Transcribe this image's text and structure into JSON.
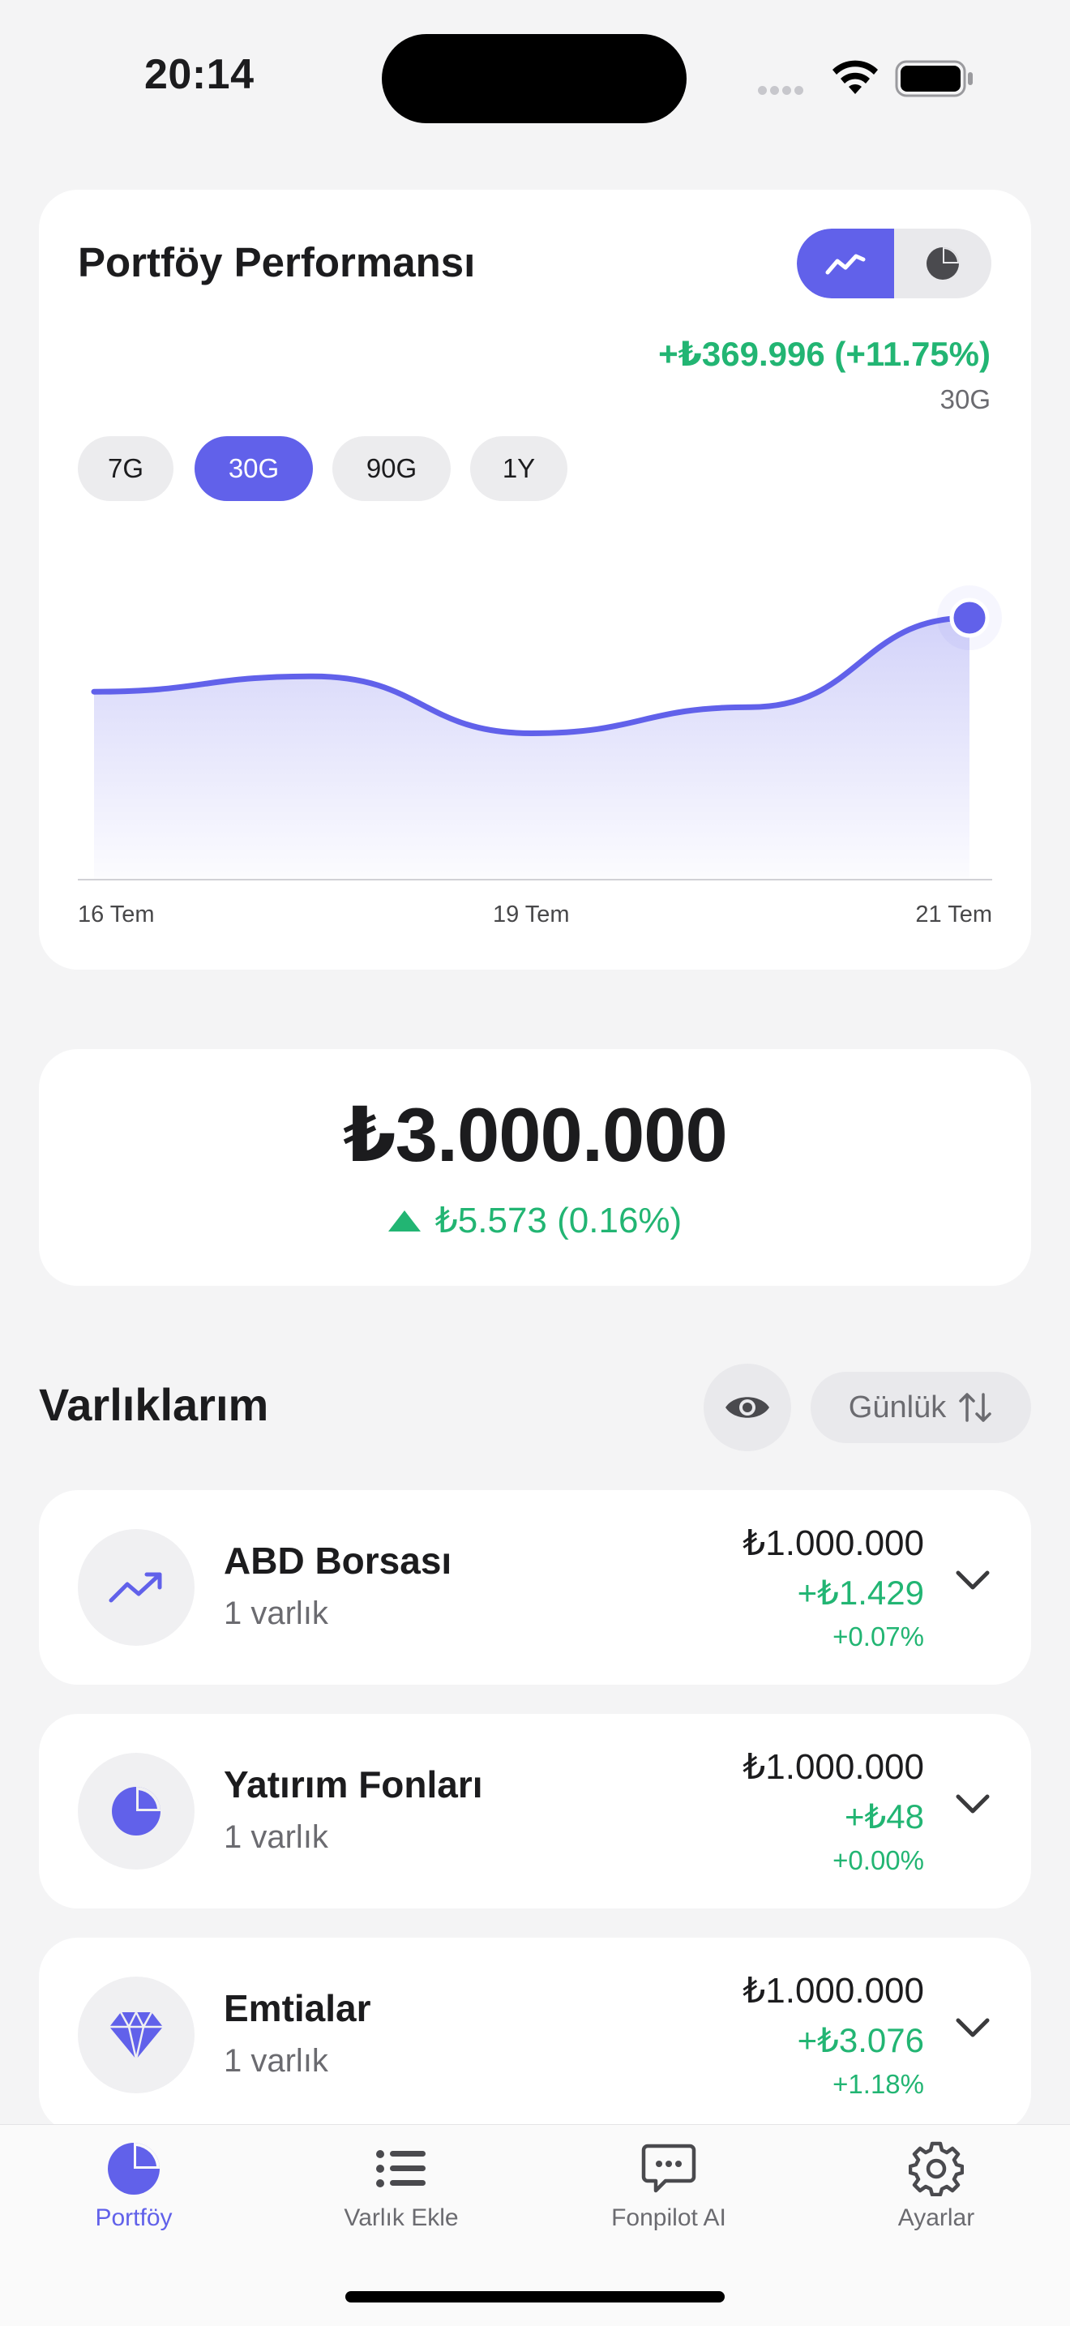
{
  "status_bar": {
    "time": "20:14"
  },
  "performance": {
    "title": "Portföy Performansı",
    "gain": "+₺369.996 (+11.75%)",
    "period": "30G",
    "periods": [
      "7G",
      "30G",
      "90G",
      "1Y"
    ],
    "active_period": "30G",
    "view_modes": [
      "line-chart-icon",
      "pie-chart-icon"
    ]
  },
  "chart_data": {
    "type": "area",
    "x": [
      "16 Tem",
      "19 Tem",
      "21 Tem"
    ],
    "xlabel": "",
    "ylabel": "",
    "grid": false,
    "legend": "none",
    "series": [
      {
        "values": [
          0.52,
          0.62,
          0.25,
          0.42,
          1.0
        ]
      }
    ],
    "colors": {
      "line": "#6161ea",
      "fill": "#6161ea"
    }
  },
  "summary": {
    "total": "₺3.000.000",
    "change": "₺5.573 (0.16%)"
  },
  "assets_section": {
    "title": "Varlıklarım",
    "sort_label": "Günlük",
    "items": [
      {
        "name": "ABD Borsası",
        "sub": "1 varlık",
        "value": "₺1.000.000",
        "gain": "+₺1.429",
        "pct": "+0.07%",
        "icon": "trend-up-icon"
      },
      {
        "name": "Yatırım Fonları",
        "sub": "1 varlık",
        "value": "₺1.000.000",
        "gain": "+₺48",
        "pct": "+0.00%",
        "icon": "pie-chart-icon"
      },
      {
        "name": "Emtialar",
        "sub": "1 varlık",
        "value": "₺1.000.000",
        "gain": "+₺3.076",
        "pct": "+1.18%",
        "icon": "diamond-icon"
      }
    ]
  },
  "tabbar": {
    "tabs": [
      {
        "label": "Portföy",
        "icon": "pie-chart-icon",
        "active": true
      },
      {
        "label": "Varlık Ekle",
        "icon": "list-icon",
        "active": false
      },
      {
        "label": "Fonpilot AI",
        "icon": "chat-bubble-icon",
        "active": false
      },
      {
        "label": "Ayarlar",
        "icon": "gear-icon",
        "active": false
      }
    ]
  },
  "colors": {
    "accent": "#6161ea",
    "positive": "#22b573",
    "background": "#f4f4f5"
  }
}
